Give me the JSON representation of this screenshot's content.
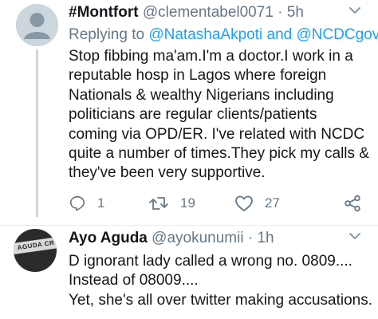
{
  "colors": {
    "text": "#14171a",
    "muted": "#657786",
    "link": "#1da1f2",
    "line": "#ccd6dd"
  },
  "tweet1": {
    "display_name": "#Montfort",
    "handle": "@clementabel0071",
    "separator": "·",
    "time": "5h",
    "reply_prefix": "Replying to",
    "reply_user1": "@NatashaAkpoti",
    "reply_and": "and",
    "reply_user2": "@NCDCgov",
    "lines": [
      "Stop fibbing ma'am.I'm a doctor.I work in a",
      "reputable hosp in Lagos where foreign",
      "Nationals & wealthy Nigerians including",
      "politicians are regular clients/patients",
      "coming via OPD/ER. I've related with NCDC",
      "quite a number of times.They pick my calls &",
      "they've been very supportive."
    ],
    "reply_count": "1",
    "retweet_count": "19",
    "like_count": "27",
    "icons": [
      "reply-icon",
      "retweet-icon",
      "like-icon",
      "share-icon",
      "chevron-down-icon",
      "default-avatar-icon"
    ]
  },
  "tweet2": {
    "display_name": "Ayo Aguda",
    "handle": "@ayokunumii",
    "separator": "·",
    "time": "1h",
    "avatar_text": "AGUDA CR",
    "lines": [
      "D ignorant lady called a wrong no. 0809....",
      "Instead of 08009....",
      "Yet, she's all over twitter making accusations."
    ]
  }
}
